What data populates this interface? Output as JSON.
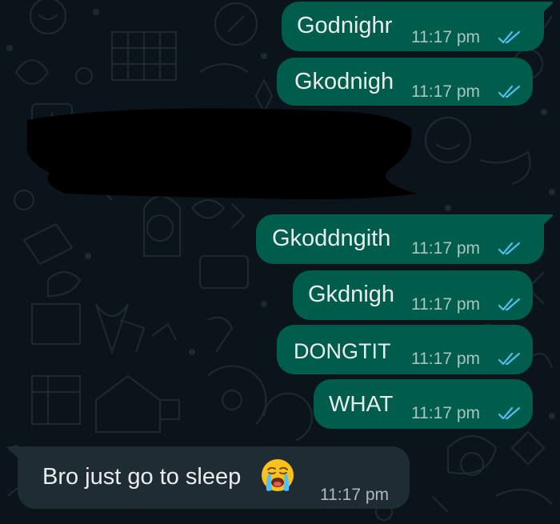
{
  "chat": {
    "outgoing": [
      {
        "text": "Godnighr",
        "time": "11:17 pm"
      },
      {
        "text": "Gkodnigh",
        "time": "11:17 pm"
      },
      {
        "text": "Gkoddngith",
        "time": "11:17 pm"
      },
      {
        "text": "Gkdnigh",
        "time": "11:17 pm"
      },
      {
        "text": "DONGTIT",
        "time": "11:17 pm"
      },
      {
        "text": "WHAT",
        "time": "11:17 pm"
      }
    ],
    "incoming": [
      {
        "text": "Bro just go to sleep",
        "emoji": "loudly-crying-face",
        "time": "11:17 pm"
      }
    ],
    "status_icon": "double-check-read-icon"
  },
  "colors": {
    "background": "#0b141a",
    "outgoing_bubble": "#005c4b",
    "incoming_bubble": "#1f2c34",
    "read_ticks": "#53bdeb",
    "text": "#e9edef"
  }
}
